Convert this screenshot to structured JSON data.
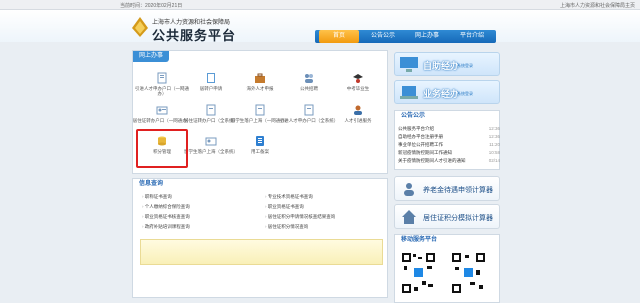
{
  "topbar": {
    "date": "当前时间：2020年02月21日",
    "right": "上海市人力资源和社会保障局主页"
  },
  "header": {
    "subtitle": "上海市人力资源和社会保障局",
    "title": "公共服务平台"
  },
  "nav": [
    {
      "label": "首页"
    },
    {
      "label": "公告公示"
    },
    {
      "label": "网上办事"
    },
    {
      "label": "平台介绍"
    }
  ],
  "services": {
    "title": "网上办事",
    "items": [
      {
        "label": "引进人才申办户口（一网通办）"
      },
      {
        "label": "居转户申请"
      },
      {
        "label": "海外人才申报"
      },
      {
        "label": "公共招聘"
      },
      {
        "label": "中考毕业生"
      },
      {
        "label": "居住证转办户口（一网通办）"
      },
      {
        "label": "居住证转办户口（全系统）"
      },
      {
        "label": "留学生落户上海（一网通办）"
      },
      {
        "label": "引进人才申办户口（全系统）"
      },
      {
        "label": "人才引进服务"
      },
      {
        "label": "积分管理"
      },
      {
        "label": "留学生落户上海（全系统）"
      },
      {
        "label": "用工备案"
      }
    ]
  },
  "info": {
    "title": "信息查询",
    "left": [
      "职称证书查询",
      "个人缴纳综合保险查询",
      "职业资格证书核查查询",
      "政府补贴培训课程查询"
    ],
    "right": [
      "专业技术资格证书查询",
      "职业资格证书查询",
      "居住证积分申请情况核查结果查询",
      "居住证积分情况查询"
    ]
  },
  "banners": [
    {
      "label": "自助经办",
      "sub": "系统登录"
    },
    {
      "label": "业务经办",
      "sub": "系统登录"
    }
  ],
  "notices": {
    "title": "公告公示",
    "items": [
      {
        "text": "公共服务平台介绍",
        "time": "12:36"
      },
      {
        "text": "自助经办平台注册手册",
        "time": "12:36"
      },
      {
        "text": "事业单位公开招聘工作",
        "time": "11:20"
      },
      {
        "text": "新冠疫情防控期间工作通知",
        "time": "10:58"
      },
      {
        "text": "关于疫情防控期间人才引进的通知",
        "time": "02/14"
      }
    ]
  },
  "calculators": [
    {
      "label": "养老金待遇申领计算器"
    },
    {
      "label": "居住证积分模拟计算器"
    }
  ],
  "mobile": {
    "title": "移动服务平台"
  }
}
